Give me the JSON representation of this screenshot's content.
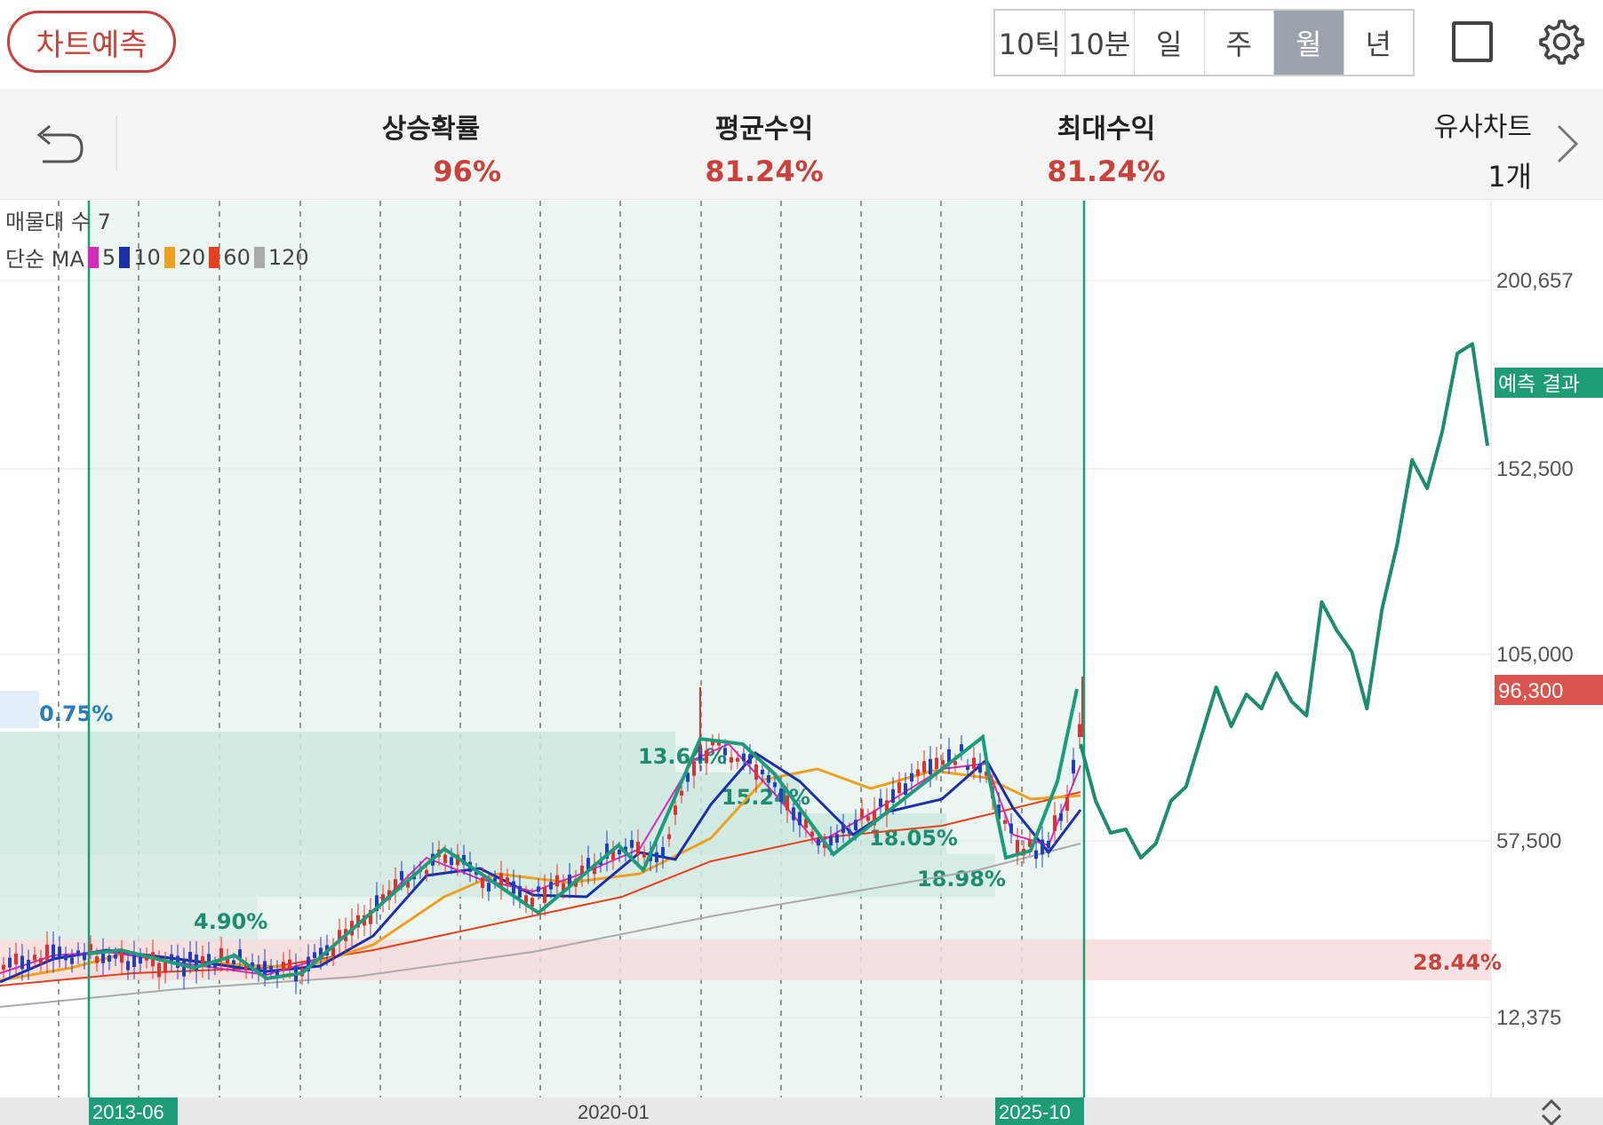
{
  "toolbar": {
    "predict_label": "차트예측",
    "periods": [
      {
        "label": "10틱",
        "active": false
      },
      {
        "label": "10분",
        "active": false
      },
      {
        "label": "일",
        "active": false
      },
      {
        "label": "주",
        "active": false
      },
      {
        "label": "월",
        "active": true
      },
      {
        "label": "년",
        "active": false
      }
    ],
    "icons": [
      "square-icon",
      "gear-icon"
    ]
  },
  "stats": {
    "rise_prob_label": "상승확률",
    "rise_prob_value": "96%",
    "avg_return_label": "평균수익",
    "avg_return_value": "81.24%",
    "max_return_label": "최대수익",
    "max_return_value": "81.24%",
    "similar_label": "유사차트",
    "similar_value": "1개"
  },
  "legend": {
    "volume_profile": "매물대 수 7",
    "ma_label": "단순 MA",
    "ma_items": [
      {
        "period": "5",
        "color": "#d42bbd"
      },
      {
        "period": "10",
        "color": "#1d2fa8"
      },
      {
        "period": "20",
        "color": "#f0a020"
      },
      {
        "period": "60",
        "color": "#e8401c"
      },
      {
        "period": "120",
        "color": "#aaaaaa"
      }
    ]
  },
  "colors": {
    "accent_red": "#c8413a",
    "prediction_green": "#1e8c6e",
    "up_candle": "#e03030",
    "down_candle": "#2040c0"
  },
  "chart_data": {
    "type": "line",
    "y_ticks": [
      "200,657",
      "152,500",
      "105,000",
      "57,500",
      "12,375"
    ],
    "ylim": [
      0,
      225000
    ],
    "x_ticks": [
      "2013-06",
      "2020-01",
      "2025-10"
    ],
    "current_price_label": "96,300",
    "prediction_label": "예측 결과",
    "profile_labels": [
      "0.75%",
      "4.90%",
      "13.64%",
      "15.24%",
      "18.05%",
      "18.98%",
      "28.44%"
    ],
    "prediction_series": {
      "name": "예측 결과",
      "values": [
        88000,
        72000,
        63000,
        64000,
        56000,
        60000,
        72000,
        76000,
        90000,
        104000,
        93000,
        102000,
        98000,
        108000,
        100000,
        96000,
        128000,
        120000,
        114000,
        98000,
        126000,
        144000,
        168000,
        160000,
        176000,
        198000,
        200657,
        172000
      ]
    }
  }
}
